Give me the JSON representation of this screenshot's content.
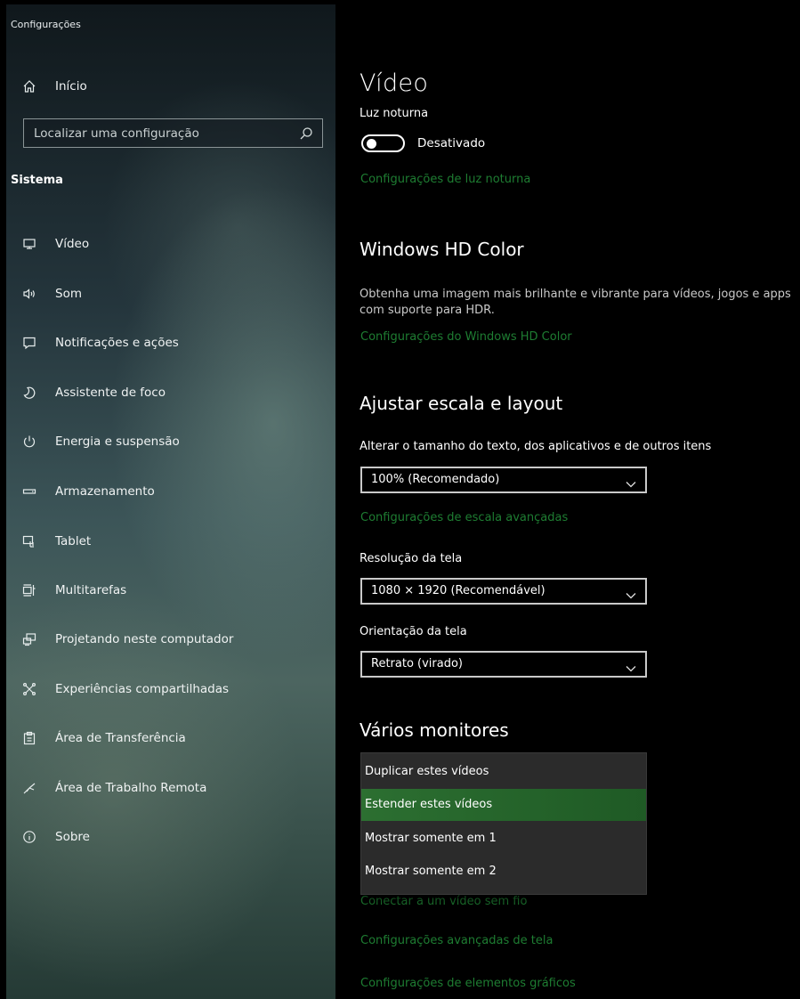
{
  "app": {
    "title": "Configurações"
  },
  "sidebar": {
    "home_label": "Início",
    "search": {
      "placeholder": "Localizar uma configuração"
    },
    "section_title": "Sistema",
    "items": [
      {
        "label": "Vídeo",
        "icon": "monitor-icon",
        "selected": true
      },
      {
        "label": "Som",
        "icon": "speaker-icon"
      },
      {
        "label": "Notificações e ações",
        "icon": "notification-icon"
      },
      {
        "label": "Assistente de foco",
        "icon": "moon-icon"
      },
      {
        "label": "Energia e suspensão",
        "icon": "power-icon"
      },
      {
        "label": "Armazenamento",
        "icon": "storage-icon"
      },
      {
        "label": "Tablet",
        "icon": "tablet-icon"
      },
      {
        "label": "Multitarefas",
        "icon": "multitask-icon"
      },
      {
        "label": "Projetando neste computador",
        "icon": "projecting-icon"
      },
      {
        "label": "Experiências compartilhadas",
        "icon": "shared-experiences-icon"
      },
      {
        "label": "Área de Transferência",
        "icon": "clipboard-icon"
      },
      {
        "label": "Área de Trabalho Remota",
        "icon": "remote-desktop-icon"
      },
      {
        "label": "Sobre",
        "icon": "info-icon"
      }
    ]
  },
  "main": {
    "title": "Vídeo",
    "night_light": {
      "label": "Luz noturna",
      "toggle_state": "Desativado",
      "settings_link": "Configurações de luz noturna"
    },
    "hd_color": {
      "heading": "Windows HD Color",
      "description": "Obtenha uma imagem mais brilhante e vibrante para vídeos, jogos e apps com suporte para HDR.",
      "link": "Configurações do Windows HD Color"
    },
    "scale_layout": {
      "heading": "Ajustar escala e layout",
      "size_label": "Alterar o tamanho do texto, dos aplicativos e de outros itens",
      "size_value": "100% (Recomendado)",
      "advanced_link": "Configurações de escala avançadas",
      "resolution_label": "Resolução da tela",
      "resolution_value": "1080 × 1920 (Recomendável)",
      "orientation_label": "Orientação da tela",
      "orientation_value": "Retrato (virado)"
    },
    "multiple_displays": {
      "heading": "Vários monitores",
      "options": [
        "Duplicar estes vídeos",
        "Estender estes vídeos",
        "Mostrar somente em 1",
        "Mostrar somente em 2"
      ],
      "selected_index": 1,
      "wireless_link": "Conectar a um vídeo sem fio"
    },
    "links": {
      "advanced_display": "Configurações avançadas de tela",
      "graphics": "Configurações de elementos gráficos"
    }
  },
  "colors": {
    "accent_link": "#1e7d32",
    "selection": "#2c6f31",
    "sidebar_indicator": "#2ea043"
  }
}
